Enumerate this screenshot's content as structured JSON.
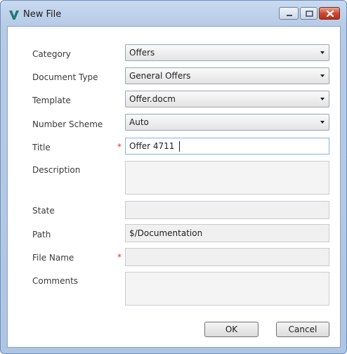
{
  "window": {
    "title": "New File",
    "icons": {
      "app": "app-logo-icon",
      "minimize": "minimize-icon",
      "maximize": "maximize-icon",
      "close": "close-icon"
    }
  },
  "form": {
    "category": {
      "label": "Category",
      "value": "Offers"
    },
    "document_type": {
      "label": "Document Type",
      "value": "General Offers"
    },
    "template": {
      "label": "Template",
      "value": "Offer.docm"
    },
    "number_scheme": {
      "label": "Number Scheme",
      "value": "Auto"
    },
    "title": {
      "label": "Title",
      "value": "Offer 4711",
      "required_marker": "*"
    },
    "description": {
      "label": "Description",
      "value": ""
    },
    "state": {
      "label": "State",
      "value": ""
    },
    "path": {
      "label": "Path",
      "value": "$/Documentation"
    },
    "file_name": {
      "label": "File Name",
      "value": "",
      "required_marker": "*"
    },
    "comments": {
      "label": "Comments",
      "value": ""
    }
  },
  "buttons": {
    "ok": "OK",
    "cancel": "Cancel"
  },
  "colors": {
    "required": "#d23b2e",
    "focus_border": "#7eb4ea",
    "title_bar": "#c9daf0"
  }
}
